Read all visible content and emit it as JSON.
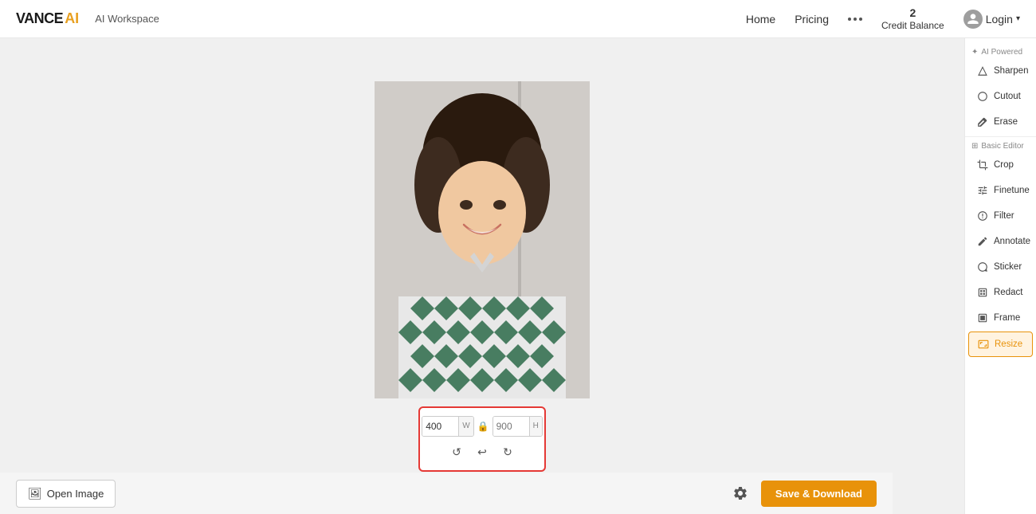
{
  "header": {
    "logo_vance": "VANCE",
    "logo_ai": "AI",
    "workspace_label": "AI Workspace",
    "nav": {
      "home": "Home",
      "pricing": "Pricing"
    },
    "credit_balance": {
      "amount": "2",
      "label": "Credit Balance"
    },
    "login_label": "Login"
  },
  "sidebar": {
    "ai_powered_label": "AI Powered",
    "items_ai": [
      {
        "id": "sharpen",
        "label": "Sharpen",
        "icon": "✦"
      },
      {
        "id": "cutout",
        "label": "Cutout",
        "icon": "✂"
      },
      {
        "id": "erase",
        "label": "Erase",
        "icon": "◎"
      }
    ],
    "basic_editor_label": "Basic Editor",
    "items_basic": [
      {
        "id": "crop",
        "label": "Crop",
        "icon": "⤢"
      },
      {
        "id": "finetune",
        "label": "Finetune",
        "icon": "⊟"
      },
      {
        "id": "filter",
        "label": "Filter",
        "icon": "⊕"
      },
      {
        "id": "annotate",
        "label": "Annotate",
        "icon": "✏"
      },
      {
        "id": "sticker",
        "label": "Sticker",
        "icon": "◔"
      },
      {
        "id": "redact",
        "label": "Redact",
        "icon": "▦"
      },
      {
        "id": "frame",
        "label": "Frame",
        "icon": "▣"
      },
      {
        "id": "resize",
        "label": "Resize",
        "icon": "⤡",
        "active": true
      }
    ]
  },
  "resize_panel": {
    "width_value": "400",
    "width_label": "W",
    "height_placeholder": "900",
    "height_label": "H",
    "lock_icon": "🔒"
  },
  "bottom_bar": {
    "open_image_label": "Open Image",
    "save_download_label": "Save & Download"
  }
}
